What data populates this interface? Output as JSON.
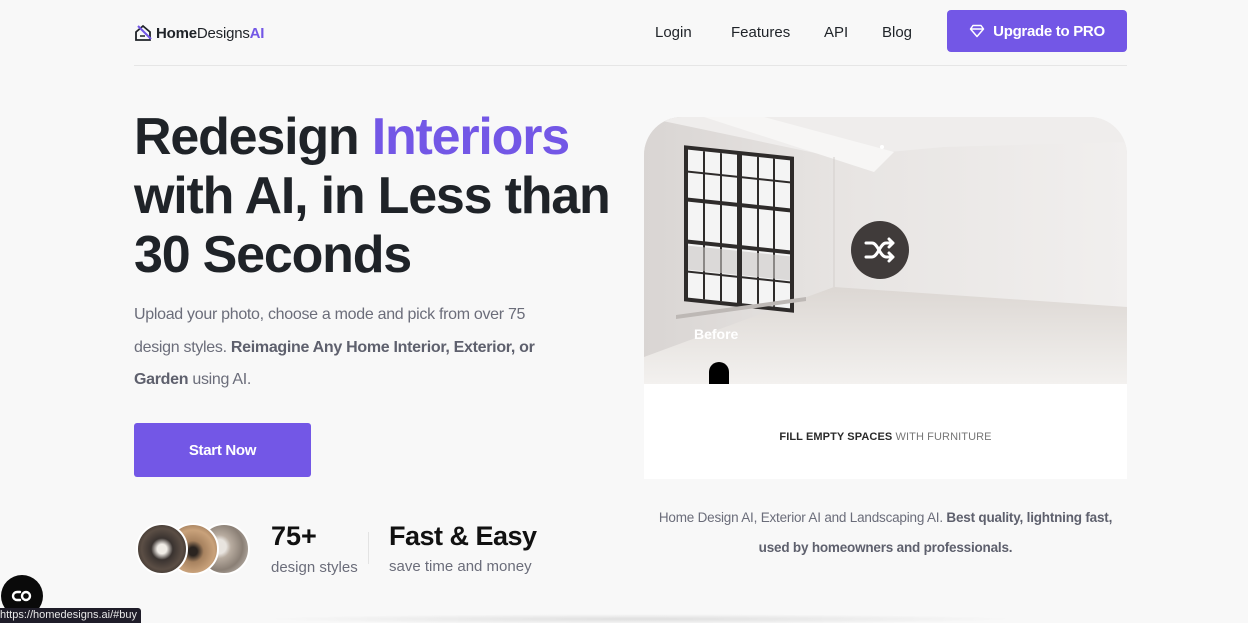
{
  "header": {
    "logo": {
      "part1": "Home",
      "part2": "Designs",
      "part3": "AI",
      "icon": "house-logo-icon"
    },
    "nav": [
      {
        "label": "Login"
      },
      {
        "label": "Features"
      },
      {
        "label": "API"
      },
      {
        "label": "Blog"
      }
    ],
    "upgrade_button": {
      "label": "Upgrade to PRO",
      "icon": "diamond-icon"
    }
  },
  "hero": {
    "title_part1": "Redesign ",
    "title_accent": "Interiors",
    "title_part2": "with AI, in Less than 30 Seconds",
    "subtitle_plain1": "Upload your photo, choose a mode and pick from over 75 design styles. ",
    "subtitle_bold1": "Reimagine Any Home Interior, Exterior, or Garden",
    "subtitle_plain2": " using AI.",
    "cta_label": "Start Now",
    "stats": {
      "styles_count": "75+",
      "styles_label": "design styles",
      "fast_title": "Fast & Easy",
      "fast_label": "save time and money"
    }
  },
  "preview": {
    "before_label": "Before",
    "shuffle_icon": "shuffle-icon",
    "caption_bold": "FILL EMPTY SPACES",
    "caption_rest": " WITH FURNITURE",
    "desc_plain": "Home Design AI, Exterior AI and Landscaping AI. ",
    "desc_bold": "Best quality, lightning fast, used by homeowners and professionals."
  },
  "overlay": {
    "chat_icon": "chat-widget-icon",
    "status_url": "https://homedesigns.ai/#buy"
  },
  "colors": {
    "brand": "#7357e6",
    "text": "#1f2328",
    "muted": "#6b6d7a",
    "background": "#f8f8f8"
  }
}
